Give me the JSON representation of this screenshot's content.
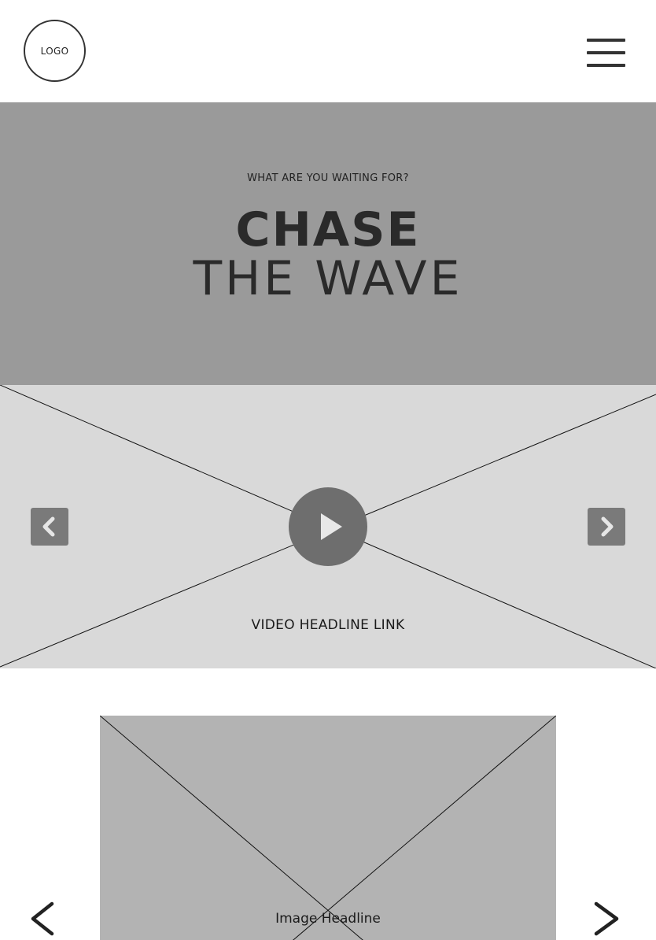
{
  "header": {
    "logo_text": "LOGO",
    "menu_icon": "hamburger-menu-icon"
  },
  "hero": {
    "kicker": "WHAT ARE YOU WAITING FOR?",
    "title_line1": "CHASE",
    "title_line2": "THE WAVE"
  },
  "video": {
    "headline_link": "VIDEO HEADLINE LINK",
    "play_icon": "play-icon",
    "prev_icon": "chevron-left-icon",
    "next_icon": "chevron-right-icon"
  },
  "carousel": {
    "image_headline": "Image Headline",
    "prev_icon": "chevron-left-icon",
    "next_icon": "chevron-right-icon"
  },
  "colors": {
    "hero_bg": "#9a9a9a",
    "video_bg": "#d9d9d9",
    "image_bg": "#b3b3b3",
    "play_button": "#6e6e6e",
    "arrow_button": "#7a7a7a",
    "text_dark": "#2a2a2a"
  }
}
